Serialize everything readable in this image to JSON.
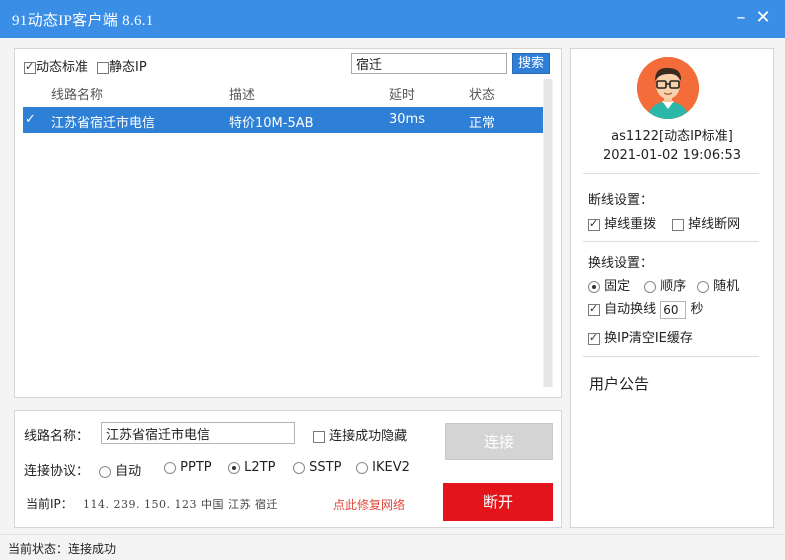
{
  "window": {
    "title": "91动态IP客户端 8.6.1",
    "min_label": "–",
    "close_label": "✕"
  },
  "filters": {
    "dynamic_label": "动态标准",
    "dynamic_checked": true,
    "static_label": "静态IP",
    "static_checked": false
  },
  "search": {
    "value": "宿迁",
    "button_label": "搜索"
  },
  "table": {
    "headers": [
      "线路名称",
      "描述",
      "延时",
      "状态"
    ],
    "rows": [
      {
        "check": "✓",
        "name": "江苏省宿迁市电信",
        "desc": "特价10M-5AB",
        "latency": "30ms",
        "status": "正常"
      }
    ]
  },
  "connection": {
    "line_name_label": "线路名称：",
    "line_name_value": "江苏省宿迁市电信",
    "hide_on_success_label": "连接成功隐藏",
    "protocol_label": "连接协议：",
    "protocols": [
      "自动",
      "PPTP",
      "L2TP",
      "SSTP",
      "IKEV2"
    ],
    "selected_protocol": "L2TP",
    "current_ip_label": "当前IP：",
    "current_ip_value": "114. 239. 150. 123  中国  江苏  宿迁",
    "fix_network_label": "点此修复网络",
    "connect_label": "连接",
    "disconnect_label": "断开"
  },
  "user": {
    "name": "as1122[动态IP标准]",
    "datetime": "2021-01-02 19:06:53",
    "disconnect_settings_label": "断线设置：",
    "redial_on_drop_label": "掉线重拨",
    "cut_net_on_drop_label": "掉线断网",
    "switch_settings_label": "换线设置：",
    "switch_modes": [
      "固定",
      "顺序",
      "随机"
    ],
    "selected_switch_mode": "固定",
    "auto_switch_label": "自动换线",
    "auto_switch_value": "60",
    "seconds_label": "秒",
    "clear_cache_label": "换IP清空IE缓存",
    "announcement_label": "用户公告"
  },
  "status": {
    "text": "当前状态：连接成功"
  },
  "colors": {
    "titlebar": "#3a8ee6",
    "selection": "#2e7fd6",
    "disconnect": "#e3151b",
    "avatar_bg": "#f36c3a"
  }
}
